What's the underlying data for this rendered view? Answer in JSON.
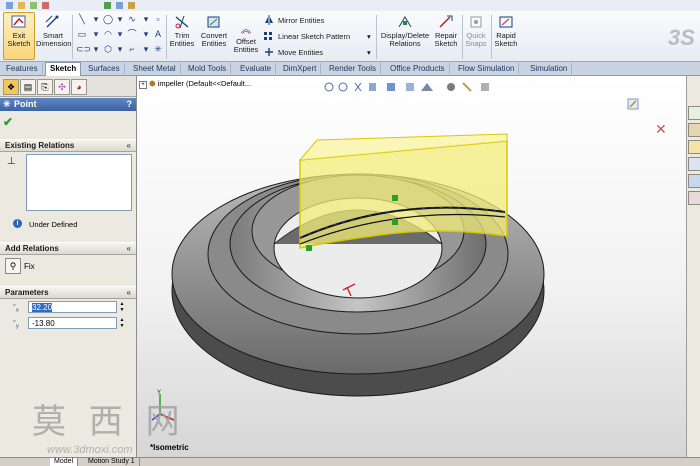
{
  "ribbon": {
    "exit_sketch": "Exit\nSketch",
    "smart_dimension": "Smart\nDimension",
    "trim_entities": "Trim\nEntities",
    "convert_entities": "Convert\nEntities",
    "offset_entities": "Offset\nEntities",
    "mirror_entities": "Mirror Entities",
    "linear_sketch_pattern": "Linear Sketch Pattern",
    "move_entities": "Move Entities",
    "display_delete_relations": "Display/Delete\nRelations",
    "repair_sketch": "Repair\nSketch",
    "quick_snaps": "Quick\nSnaps",
    "rapid_sketch": "Rapid\nSketch"
  },
  "tabs": [
    "Features",
    "Sketch",
    "Surfaces",
    "Sheet Metal",
    "Mold Tools",
    "Evaluate",
    "DimXpert",
    "Render Tools",
    "Office Products",
    "Flow Simulation",
    "Simulation"
  ],
  "active_tab": "Sketch",
  "tree": {
    "item": "impeller  (Default<<Default..."
  },
  "panel": {
    "title": "Point",
    "help": "?",
    "existing_relations": "Existing Relations",
    "status": "Under Defined",
    "add_relations": "Add Relations",
    "fix": "Fix",
    "parameters": "Parameters",
    "x_label": "x",
    "y_label": "y",
    "x_value": "32.20",
    "y_value": "-13.80"
  },
  "view": {
    "orientation": "*Isometric"
  },
  "bottom_tabs": [
    "Model",
    "Motion Study 1"
  ],
  "watermark": {
    "text": "莫 西 网",
    "url": "www.3dmoxi.com"
  },
  "colors": {
    "accent": "#3c63a2",
    "sketch_face": "#f2ee7a",
    "part": "#9a9a9a"
  }
}
